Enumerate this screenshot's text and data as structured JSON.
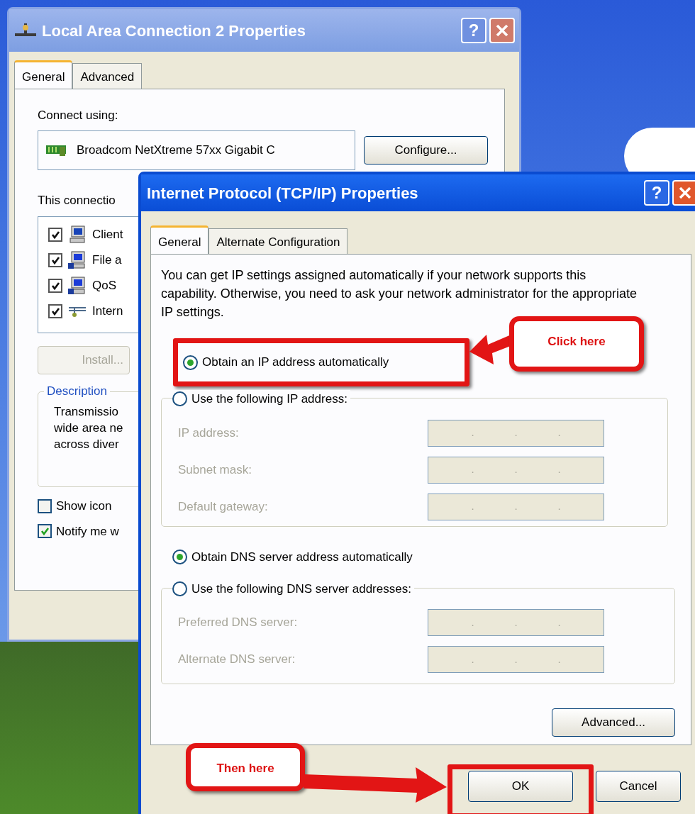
{
  "back_window": {
    "title": "Local Area Connection 2 Properties",
    "help": "?",
    "tabs": [
      {
        "label": "General",
        "selected": true
      },
      {
        "label": "Advanced",
        "selected": false
      }
    ],
    "connect_using_label": "Connect using:",
    "adapter": "Broadcom NetXtreme 57xx Gigabit C",
    "configure_button": "Configure...",
    "components_label": "This connectio",
    "components": [
      {
        "label": "Client",
        "checked": true,
        "kind": "computer"
      },
      {
        "label": "File a",
        "checked": true,
        "kind": "shared"
      },
      {
        "label": "QoS",
        "checked": true,
        "kind": "shared"
      },
      {
        "label": "Intern",
        "checked": true,
        "kind": "protocol"
      }
    ],
    "install_button": {
      "label": "Install...",
      "disabled": true
    },
    "description": {
      "heading": "Description",
      "lines": [
        "Transmissio",
        "wide area ne",
        "across diver"
      ]
    },
    "options": [
      {
        "label": "Show icon",
        "checked": false
      },
      {
        "label": "Notify me w",
        "checked": true
      }
    ]
  },
  "front_window": {
    "title": "Internet Protocol (TCP/IP) Properties",
    "help": "?",
    "tabs": [
      {
        "label": "General",
        "selected": true
      },
      {
        "label": "Alternate Configuration",
        "selected": false
      }
    ],
    "intro": "You can get IP settings assigned automatically if your network supports this capability. Otherwise, you need to ask your network administrator for the appropriate IP settings.",
    "ip_radios": [
      {
        "label": "Obtain an IP address automatically",
        "selected": true
      },
      {
        "label": "Use the following IP address:",
        "selected": false
      }
    ],
    "ip_fields": [
      {
        "label": "IP address:",
        "disabled": true,
        "separators": [
          ".",
          ".",
          "."
        ]
      },
      {
        "label": "Subnet mask:",
        "disabled": true,
        "separators": [
          ".",
          ".",
          "."
        ]
      },
      {
        "label": "Default gateway:",
        "disabled": true,
        "separators": [
          ".",
          ".",
          "."
        ]
      }
    ],
    "dns_radios": [
      {
        "label": "Obtain DNS server address automatically",
        "selected": true
      },
      {
        "label": "Use the following DNS server addresses:",
        "selected": false
      }
    ],
    "dns_fields": [
      {
        "label": "Preferred DNS server:",
        "disabled": true,
        "separators": [
          ".",
          ".",
          "."
        ]
      },
      {
        "label": "Alternate DNS server:",
        "disabled": true,
        "separators": [
          ".",
          ".",
          "."
        ]
      }
    ],
    "advanced_button": "Advanced...",
    "ok_button": "OK",
    "cancel_button": "Cancel"
  },
  "annotations": [
    {
      "text": "Click here"
    },
    {
      "text": "Then here"
    }
  ]
}
